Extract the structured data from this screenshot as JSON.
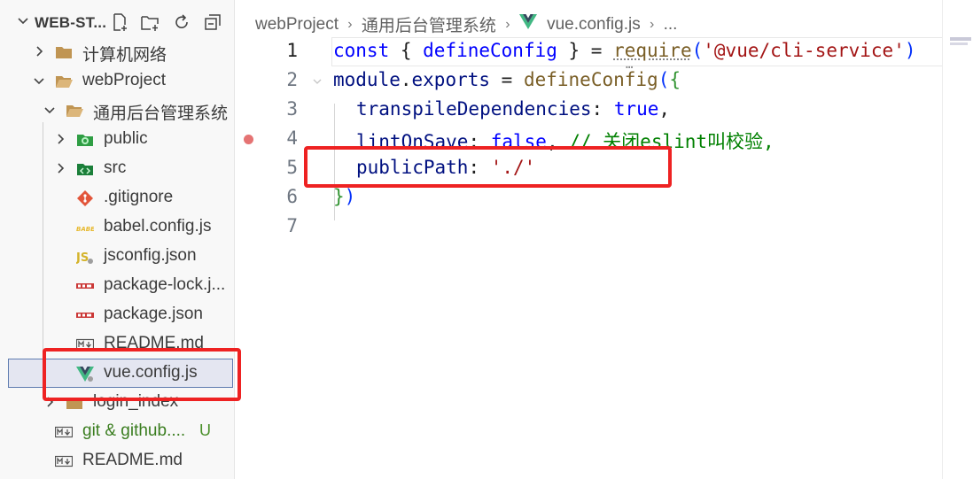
{
  "explorer": {
    "title": "WEB-ST...",
    "items": [
      {
        "label": "计算机网络",
        "icon": "folder-icon"
      },
      {
        "label": "webProject",
        "icon": "folder-open-icon"
      },
      {
        "label": "通用后台管理系统",
        "icon": "folder-open-icon"
      },
      {
        "label": "public",
        "icon": "public-folder-icon"
      },
      {
        "label": "src",
        "icon": "src-folder-icon"
      },
      {
        "label": ".gitignore",
        "icon": "git-icon"
      },
      {
        "label": "babel.config.js",
        "icon": "babel-icon"
      },
      {
        "label": "jsconfig.json",
        "icon": "js-icon"
      },
      {
        "label": "package-lock.j...",
        "icon": "npm-icon"
      },
      {
        "label": "package.json",
        "icon": "npm-icon"
      },
      {
        "label": "README.md",
        "icon": "markdown-icon"
      },
      {
        "label": "vue.config.js",
        "icon": "vue-icon"
      },
      {
        "label": "login_index",
        "icon": "folder-icon"
      },
      {
        "label": "git & github....",
        "icon": "markdown-icon",
        "status": "U"
      },
      {
        "label": "README.md",
        "icon": "markdown-icon"
      }
    ]
  },
  "breadcrumb": {
    "parts": [
      "webProject",
      "通用后台管理系统",
      "vue.config.js",
      "..."
    ]
  },
  "editor": {
    "line_numbers": [
      "1",
      "2",
      "3",
      "4",
      "5",
      "6",
      "7"
    ],
    "active_line": "1",
    "code": {
      "l1": {
        "kw": "const",
        "o": " { ",
        "fn1": "defineConfig",
        "c": " } = ",
        "fn2": "require",
        "p1": "(",
        "s": "'@vue/cli-service'",
        "p2": ")"
      },
      "l2": {
        "a": "module",
        "dot": ".",
        "b": "exports",
        "eq": " = ",
        "fn": "defineConfig",
        "p": "(",
        "br": "{"
      },
      "l3": {
        "prop": "transpileDependencies",
        "col": ": ",
        "val": "true",
        "cm": ","
      },
      "l4": {
        "prop": "lintOnSave",
        "col": ": ",
        "val": "false",
        "cm": ", ",
        "comment": "// 关闭eslint叫校验,"
      },
      "l5": {
        "prop": "publicPath",
        "col": ": ",
        "val": "'./'"
      },
      "l6": {
        "br": "}",
        "p": ")"
      }
    }
  },
  "colors": {
    "highlight": "#ee2222",
    "keyword": "#0000ff",
    "string": "#a31515",
    "property": "#001080",
    "function": "#795e26",
    "comment": "#008000"
  }
}
